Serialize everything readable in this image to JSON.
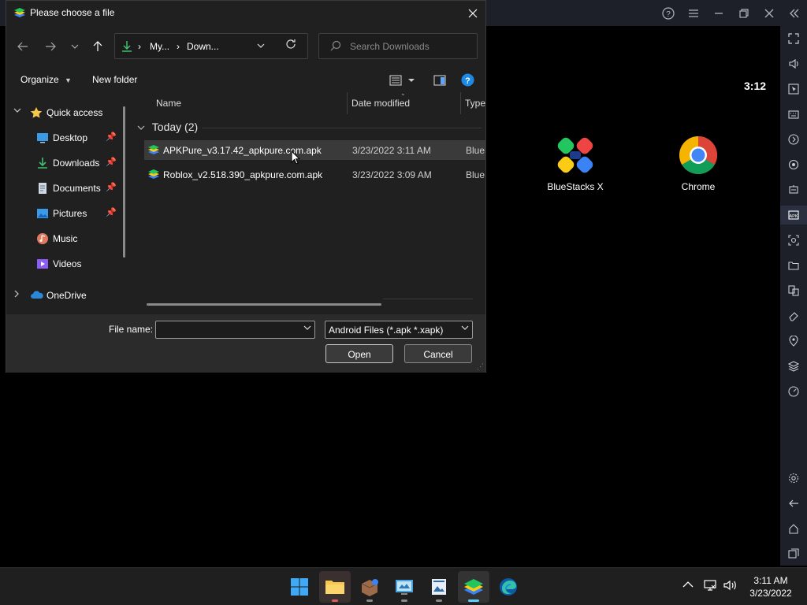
{
  "dialog": {
    "title": "Please choose a file",
    "address": {
      "crumbs": [
        "My...",
        "Down..."
      ]
    },
    "search_placeholder": "Search Downloads",
    "toolbar": {
      "organize": "Organize",
      "new_folder": "New folder"
    },
    "nav": {
      "items": [
        {
          "label": "Quick access",
          "icon": "star-icon",
          "pinned": false
        },
        {
          "label": "Desktop",
          "icon": "desktop-icon",
          "pinned": true
        },
        {
          "label": "Downloads",
          "icon": "download-icon",
          "pinned": true
        },
        {
          "label": "Documents",
          "icon": "documents-icon",
          "pinned": true
        },
        {
          "label": "Pictures",
          "icon": "pictures-icon",
          "pinned": true
        },
        {
          "label": "Music",
          "icon": "music-icon",
          "pinned": false
        },
        {
          "label": "Videos",
          "icon": "videos-icon",
          "pinned": false
        },
        {
          "label": "OneDrive",
          "icon": "onedrive-icon",
          "pinned": false
        }
      ]
    },
    "columns": {
      "name": "Name",
      "date": "Date modified",
      "type": "Type"
    },
    "group": "Today (2)",
    "files": [
      {
        "name": "APKPure_v3.17.42_apkpure.com.apk",
        "date": "3/23/2022 3:11 AM",
        "type": "BlueStacks",
        "selected": true
      },
      {
        "name": "Roblox_v2.518.390_apkpure.com.apk",
        "date": "3/23/2022 3:09 AM",
        "type": "BlueStacks",
        "selected": false
      }
    ],
    "file_name_label": "File name:",
    "file_name_value": "",
    "file_type": "Android Files (*.apk *.xapk)",
    "open_label": "Open",
    "cancel_label": "Cancel"
  },
  "android": {
    "clock": "3:12",
    "apps": [
      {
        "label": "BlueStacks X"
      },
      {
        "label": "Chrome"
      }
    ]
  },
  "taskbar": {
    "time": "3:11 AM",
    "date": "3/23/2022"
  },
  "colors": {
    "accent": "#60cdff",
    "folder": "#f8c84a",
    "download": "#3fbf6f"
  }
}
